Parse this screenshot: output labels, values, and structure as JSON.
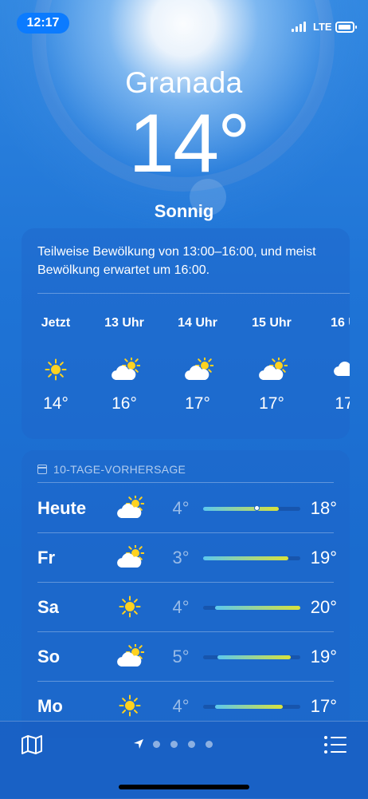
{
  "status_bar": {
    "time": "12:17",
    "network": "LTE",
    "time_color": "#0b7bff"
  },
  "location": {
    "city": "Granada",
    "temperature": "14°",
    "condition": "Sonnig"
  },
  "hourly": {
    "summary": "Teilweise Bewölkung von 13:00–16:00, und meist Bewölkung erwartet um 16:00.",
    "items": [
      {
        "label": "Jetzt",
        "icon": "sun-icon",
        "temp": "14°"
      },
      {
        "label": "13 Uhr",
        "icon": "partly-cloudy-icon",
        "temp": "16°"
      },
      {
        "label": "14 Uhr",
        "icon": "partly-cloudy-icon",
        "temp": "17°"
      },
      {
        "label": "15 Uhr",
        "icon": "partly-cloudy-icon",
        "temp": "17°"
      },
      {
        "label": "16 U",
        "icon": "cloud-icon",
        "temp": "17"
      }
    ]
  },
  "daily": {
    "header": "10-TAGE-VORHERSAGE",
    "items": [
      {
        "day": "Heute",
        "icon": "partly-cloudy-icon",
        "low": "4°",
        "high": "18°",
        "range_start": 0.0,
        "range_end": 0.78,
        "current_marker": 0.55
      },
      {
        "day": "Fr",
        "icon": "partly-cloudy-icon",
        "low": "3°",
        "high": "19°",
        "range_start": 0.0,
        "range_end": 0.88
      },
      {
        "day": "Sa",
        "icon": "sun-icon",
        "low": "4°",
        "high": "20°",
        "range_start": 0.12,
        "range_end": 1.0
      },
      {
        "day": "So",
        "icon": "partly-cloudy-icon",
        "low": "5°",
        "high": "19°",
        "range_start": 0.15,
        "range_end": 0.9
      },
      {
        "day": "Mo",
        "icon": "sun-icon",
        "low": "4°",
        "high": "17°",
        "range_start": 0.12,
        "range_end": 0.82
      }
    ]
  },
  "bottom_bar": {
    "left_icon": "map-icon",
    "center_icon": "location-arrow-icon",
    "page_count": 4,
    "right_icon": "list-icon"
  },
  "colors": {
    "range_gradient_start": "#5cc8ef",
    "range_gradient_end": "#d9e23a",
    "sun": "#ffd21f"
  }
}
